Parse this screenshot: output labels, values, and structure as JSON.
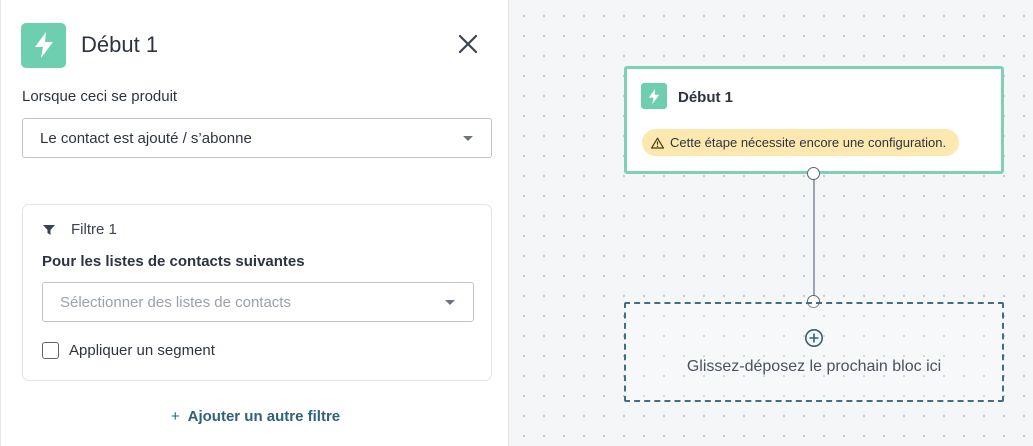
{
  "panel": {
    "title": "Début 1",
    "trigger_label": "Lorsque ceci se produit",
    "trigger_value": "Le contact est ajouté / s’abonne",
    "filter": {
      "title": "Filtre 1",
      "lists_label": "Pour les listes de contacts suivantes",
      "lists_placeholder": "Sélectionner des listes de contacts",
      "segment_label": "Appliquer un segment",
      "segment_checked": false
    },
    "add_filter_label": "Ajouter un autre filtre"
  },
  "canvas": {
    "node": {
      "title": "Début 1",
      "warning": "Cette étape nécessite encore une configuration."
    },
    "dropzone_text": "Glissez-déposez le prochain bloc ici"
  },
  "icons": {
    "bolt": "bolt-icon",
    "close": "close-icon",
    "filter": "filter-icon",
    "caret": "caret-down-icon",
    "warning": "warning-icon",
    "add": "add-circle-icon"
  },
  "colors": {
    "accent_green": "#6dcfb0",
    "node_border": "#7fd0b6",
    "warning_bg": "#fde9b0",
    "link_blue": "#2f6179",
    "dropzone_border": "#3d6f88"
  }
}
